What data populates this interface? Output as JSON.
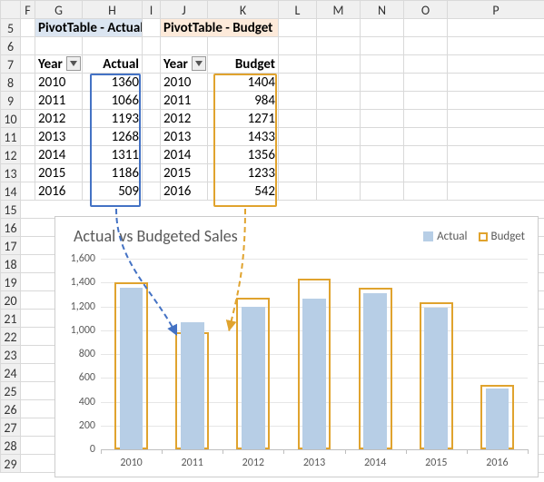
{
  "columns": [
    "F",
    "G",
    "H",
    "I",
    "J",
    "K",
    "L",
    "M",
    "N",
    "O",
    "P"
  ],
  "rows": [
    "5",
    "6",
    "7",
    "8",
    "9",
    "10",
    "11",
    "12",
    "13",
    "14",
    "15",
    "16",
    "17",
    "18",
    "19",
    "20",
    "21",
    "22",
    "23",
    "24",
    "25",
    "26",
    "27",
    "28",
    "29"
  ],
  "titles": {
    "actual": "PivotTable - Actual",
    "budget": "PivotTable - Budget"
  },
  "headers": {
    "year_a": "Year",
    "actual": "Actual",
    "year_b": "Year",
    "budget": "Budget"
  },
  "table": {
    "years": [
      "2010",
      "2011",
      "2012",
      "2013",
      "2014",
      "2015",
      "2016"
    ],
    "actual": [
      1360,
      1066,
      1193,
      1268,
      1311,
      1186,
      509
    ],
    "budget": [
      1404,
      984,
      1271,
      1433,
      1356,
      1233,
      542
    ]
  },
  "chart_data": {
    "type": "bar",
    "title": "Actual vs Budgeted Sales",
    "categories": [
      "2010",
      "2011",
      "2012",
      "2013",
      "2014",
      "2015",
      "2016"
    ],
    "series": [
      {
        "name": "Actual",
        "values": [
          1360,
          1066,
          1193,
          1268,
          1311,
          1186,
          509
        ]
      },
      {
        "name": "Budget",
        "values": [
          1404,
          984,
          1271,
          1433,
          1356,
          1233,
          542
        ]
      }
    ],
    "ylim": [
      0,
      1600
    ],
    "yticks": [
      0,
      200,
      400,
      600,
      800,
      1000,
      1200,
      1400,
      1600
    ],
    "yticklabels": [
      "0",
      "200",
      "400",
      "600",
      "800",
      "1,000",
      "1,200",
      "1,400",
      "1,600"
    ],
    "legend": {
      "actual": "Actual",
      "budget": "Budget"
    }
  },
  "colors": {
    "actual_fill": "#b7cee6",
    "budget_stroke": "#e0a32e",
    "actual_box": "#4472c4"
  }
}
